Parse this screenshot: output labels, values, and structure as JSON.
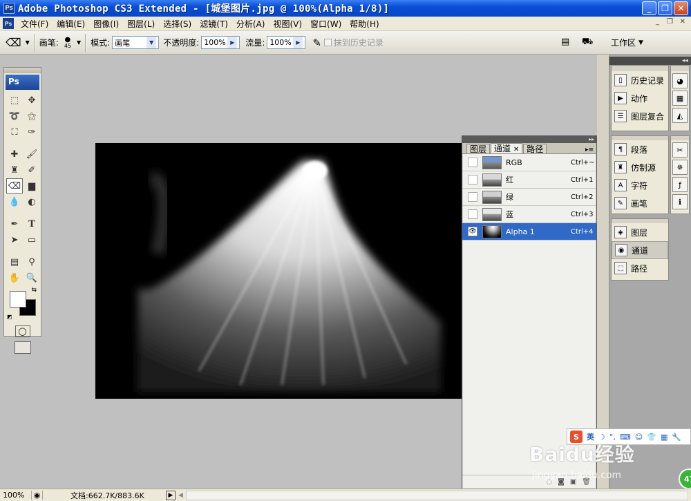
{
  "window": {
    "app_icon": "Ps",
    "title": "Adobe Photoshop CS3 Extended - [城堡图片.jpg @ 100%(Alpha 1/8)]",
    "controls": [
      "_",
      "❐",
      "✕"
    ]
  },
  "menubar": {
    "items": [
      "文件(F)",
      "编辑(E)",
      "图像(I)",
      "图层(L)",
      "选择(S)",
      "滤镜(T)",
      "分析(A)",
      "视图(V)",
      "窗口(W)",
      "帮助(H)"
    ],
    "doc_controls": [
      "_",
      "❐",
      "✕"
    ]
  },
  "options": {
    "brush_label": "画笔:",
    "brush_size": "45",
    "mode_label": "模式:",
    "mode_value": "画笔",
    "opacity_label": "不透明度:",
    "opacity_value": "100%",
    "flow_label": "流量:",
    "flow_value": "100%",
    "history_label": "抹到历史记录",
    "workspace_label": "工作区"
  },
  "toolbox": {
    "logo": "Ps"
  },
  "dock": {
    "collapse": "◂◂",
    "group1": [
      {
        "label": "历史记录",
        "icon": "history-icon"
      },
      {
        "label": "动作",
        "icon": "actions-icon"
      },
      {
        "label": "图层复合",
        "icon": "layer-comps-icon"
      }
    ],
    "group2": [
      {
        "label": "段落",
        "icon": "paragraph-icon"
      },
      {
        "label": "仿制源",
        "icon": "clone-source-icon"
      },
      {
        "label": "字符",
        "icon": "character-icon"
      },
      {
        "label": "画笔",
        "icon": "brushes-icon"
      }
    ],
    "group3": [
      {
        "label": "图层",
        "icon": "layers-icon"
      },
      {
        "label": "通道",
        "icon": "channels-icon"
      },
      {
        "label": "路径",
        "icon": "paths-icon"
      }
    ]
  },
  "channels_panel": {
    "tabs": [
      "图层",
      "通道",
      "路径"
    ],
    "active_tab": "通道",
    "rows": [
      {
        "name": "RGB",
        "shortcut": "Ctrl+~",
        "visible": false
      },
      {
        "name": "红",
        "shortcut": "Ctrl+1",
        "visible": false
      },
      {
        "name": "绿",
        "shortcut": "Ctrl+2",
        "visible": false
      },
      {
        "name": "蓝",
        "shortcut": "Ctrl+3",
        "visible": false
      },
      {
        "name": "Alpha 1",
        "shortcut": "Ctrl+4",
        "visible": true
      }
    ]
  },
  "status": {
    "zoom": "100%",
    "doc_info": "文档:662.7K/883.6K"
  },
  "watermark": {
    "text": "Baidu经验",
    "url": "jingyan.baidu.com"
  },
  "colors": {
    "title_bar": "#0a4fd6",
    "selection": "#3169c6",
    "workspace": "#c0c0c0"
  }
}
